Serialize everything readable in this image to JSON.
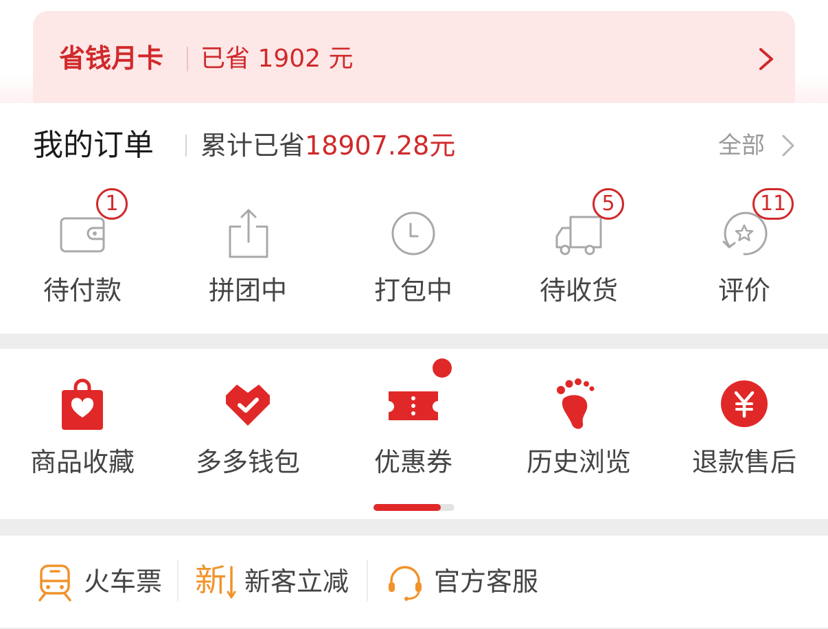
{
  "savings_card": {
    "title": "省钱月卡",
    "saved_text": "已省 1902 元"
  },
  "orders": {
    "title": "我的订单",
    "saved_prefix": "累计已省",
    "saved_amount": "18907.28元",
    "all_label": "全部",
    "items": [
      {
        "label": "待付款",
        "badge": "1",
        "icon": "wallet-icon"
      },
      {
        "label": "拼团中",
        "badge": "",
        "icon": "share-icon"
      },
      {
        "label": "打包中",
        "badge": "",
        "icon": "clock-icon"
      },
      {
        "label": "待收货",
        "badge": "5",
        "icon": "truck-icon"
      },
      {
        "label": "评价",
        "badge": "11",
        "icon": "review-star-icon"
      }
    ]
  },
  "tools": {
    "items": [
      {
        "label": "商品收藏",
        "icon": "shopping-bag-heart-icon"
      },
      {
        "label": "多多钱包",
        "icon": "heart-wallet-icon"
      },
      {
        "label": "优惠券",
        "icon": "coupon-icon"
      },
      {
        "label": "历史浏览",
        "icon": "footprint-icon"
      },
      {
        "label": "退款售后",
        "icon": "yuan-coin-icon"
      }
    ],
    "coupon_dot": true,
    "scroll_progress": 0.83
  },
  "services": {
    "items": [
      {
        "label": "火车票",
        "icon": "train-icon"
      },
      {
        "label": "新客立减",
        "icon": "new-customer-icon",
        "icon_text": "新"
      },
      {
        "label": "官方客服",
        "icon": "headset-icon"
      }
    ]
  },
  "colors": {
    "accent": "#d0292a",
    "orange": "#f0932b",
    "icon_gray": "#a8a8a8"
  }
}
